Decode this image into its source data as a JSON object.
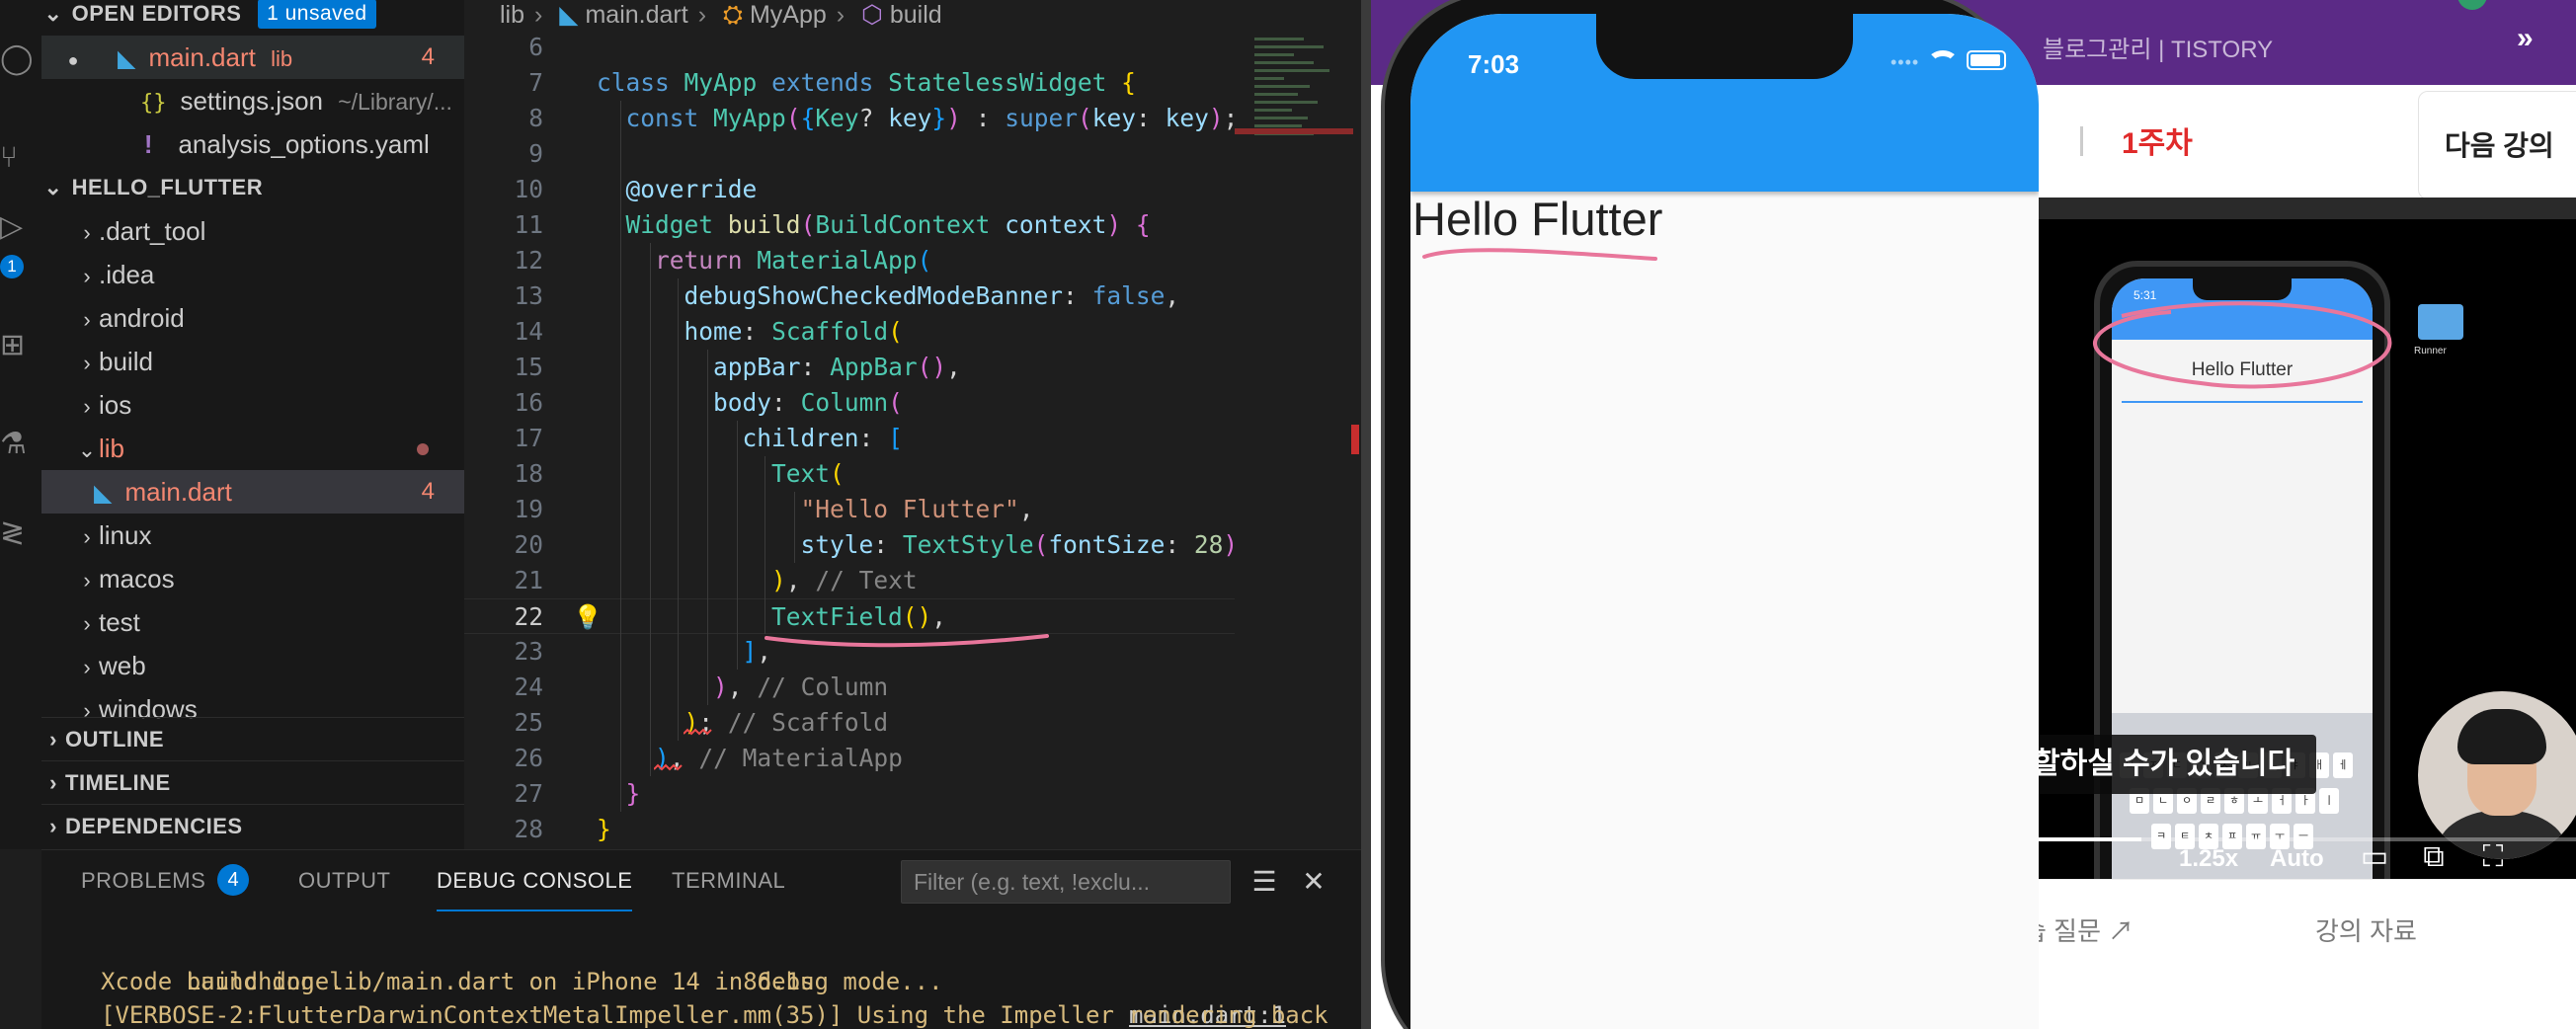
{
  "explorer": {
    "open_editors_label": "OPEN EDITORS",
    "unsaved_badge": "1 unsaved",
    "open_files": [
      {
        "name": "main.dart",
        "dir": "lib",
        "count": "4"
      },
      {
        "name": "settings.json",
        "dir": "~/Library/..."
      },
      {
        "name": "analysis_options.yaml"
      }
    ],
    "workspace_label": "HELLO_FLUTTER",
    "folders": [
      ".dart_tool",
      ".idea",
      "android",
      "build",
      "ios",
      "lib",
      "linux",
      "macos",
      "test",
      "web",
      "windows"
    ],
    "lib_child": {
      "name": "main.dart",
      "count": "4"
    },
    "outline_label": "OUTLINE",
    "timeline_label": "TIMELINE",
    "dependencies_label": "DEPENDENCIES"
  },
  "activity": {
    "badge": "1"
  },
  "breadcrumb": {
    "folder": "lib",
    "file": "main.dart",
    "class": "MyApp",
    "method": "build"
  },
  "editor": {
    "line_numbers": [
      "6",
      "7",
      "8",
      "9",
      "10",
      "11",
      "12",
      "13",
      "14",
      "15",
      "16",
      "17",
      "18",
      "19",
      "20",
      "21",
      "22",
      "23",
      "24",
      "25",
      "26",
      "27",
      "28"
    ],
    "current_line": "22",
    "comment_text": "// Text",
    "comment_column": "// Column",
    "comment_scaffold": "// Scaffold",
    "comment_material": "// MaterialApp",
    "string_hello": "\"Hello Flutter\"",
    "font_size_value": "28"
  },
  "panel": {
    "tabs": {
      "problems": "PROBLEMS",
      "output": "OUTPUT",
      "debug": "DEBUG CONSOLE",
      "terminal": "TERMINAL"
    },
    "problems_count": "4",
    "filter_placeholder": "Filter (e.g. text, !exclu...",
    "console": [
      {
        "text": "Launching lib/main.dart on iPhone 14 in debug mode...",
        "link": "main.dart:1"
      },
      {
        "text": "Xcode build done.                            86.1s"
      },
      {
        "text": "[VERBOSE-2:FlutterDarwinContextMetalImpeller.mm(35)] Using the Impeller rendering back"
      }
    ]
  },
  "simulator": {
    "time": "7:03",
    "body_text": "Hello Flutter"
  },
  "video_page": {
    "tab_title": "블로그관리 | TISTORY",
    "tab_arrow": "»",
    "week": "1주차",
    "next_lesson": "다음 강의",
    "caption": "할하실 수가 있습니다",
    "speed": "1.25x",
    "quality": "Auto",
    "qa_link": "습 질문",
    "materials_link": "강의 자료",
    "inner_phone_time": "5:31",
    "inner_hello": "Hello Flutter",
    "inner_folder_label": "Runner"
  },
  "colors": {
    "accent": "#0078d4",
    "appbar": "#2196f3",
    "error": "#f48771",
    "annotation": "#e8769b"
  }
}
